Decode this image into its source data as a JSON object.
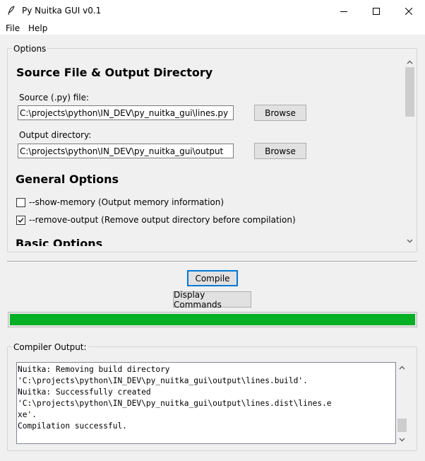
{
  "window": {
    "title": "Py Nuitka GUI v0.1",
    "app_icon": "feather-icon",
    "controls": [
      "minimize-icon",
      "maximize-icon",
      "close-icon"
    ]
  },
  "menubar": {
    "items": [
      "File",
      "Help"
    ]
  },
  "options": {
    "group_label": "Options",
    "source_section": {
      "heading": "Source File & Output Directory",
      "source_label": "Source (.py) file:",
      "source_value": "C:\\projects\\python\\IN_DEV\\py_nuitka_gui\\lines.py",
      "source_browse": "Browse",
      "output_label": "Output directory:",
      "output_value": "C:\\projects\\python\\IN_DEV\\py_nuitka_gui\\output",
      "output_browse": "Browse"
    },
    "general_section": {
      "heading": "General Options",
      "show_memory": {
        "label": "--show-memory (Output memory information)",
        "checked": false
      },
      "remove_output": {
        "label": "--remove-output (Remove output directory before compilation)",
        "checked": true
      }
    },
    "basic_section": {
      "heading": "Basic Options"
    }
  },
  "actions": {
    "compile_label": "Compile",
    "display_commands_label": "Display Commands"
  },
  "progress": {
    "value_percent": 100,
    "color": "#06b025"
  },
  "compiler_output": {
    "group_label": "Compiler Output:",
    "lines": [
      "Nuitka: Removing build directory",
      "'C:\\projects\\python\\IN_DEV\\py_nuitka_gui\\output\\lines.build'.",
      "Nuitka: Successfully created",
      "'C:\\projects\\python\\IN_DEV\\py_nuitka_gui\\output\\lines.dist\\lines.e",
      "xe'.",
      "Compilation successful."
    ]
  }
}
